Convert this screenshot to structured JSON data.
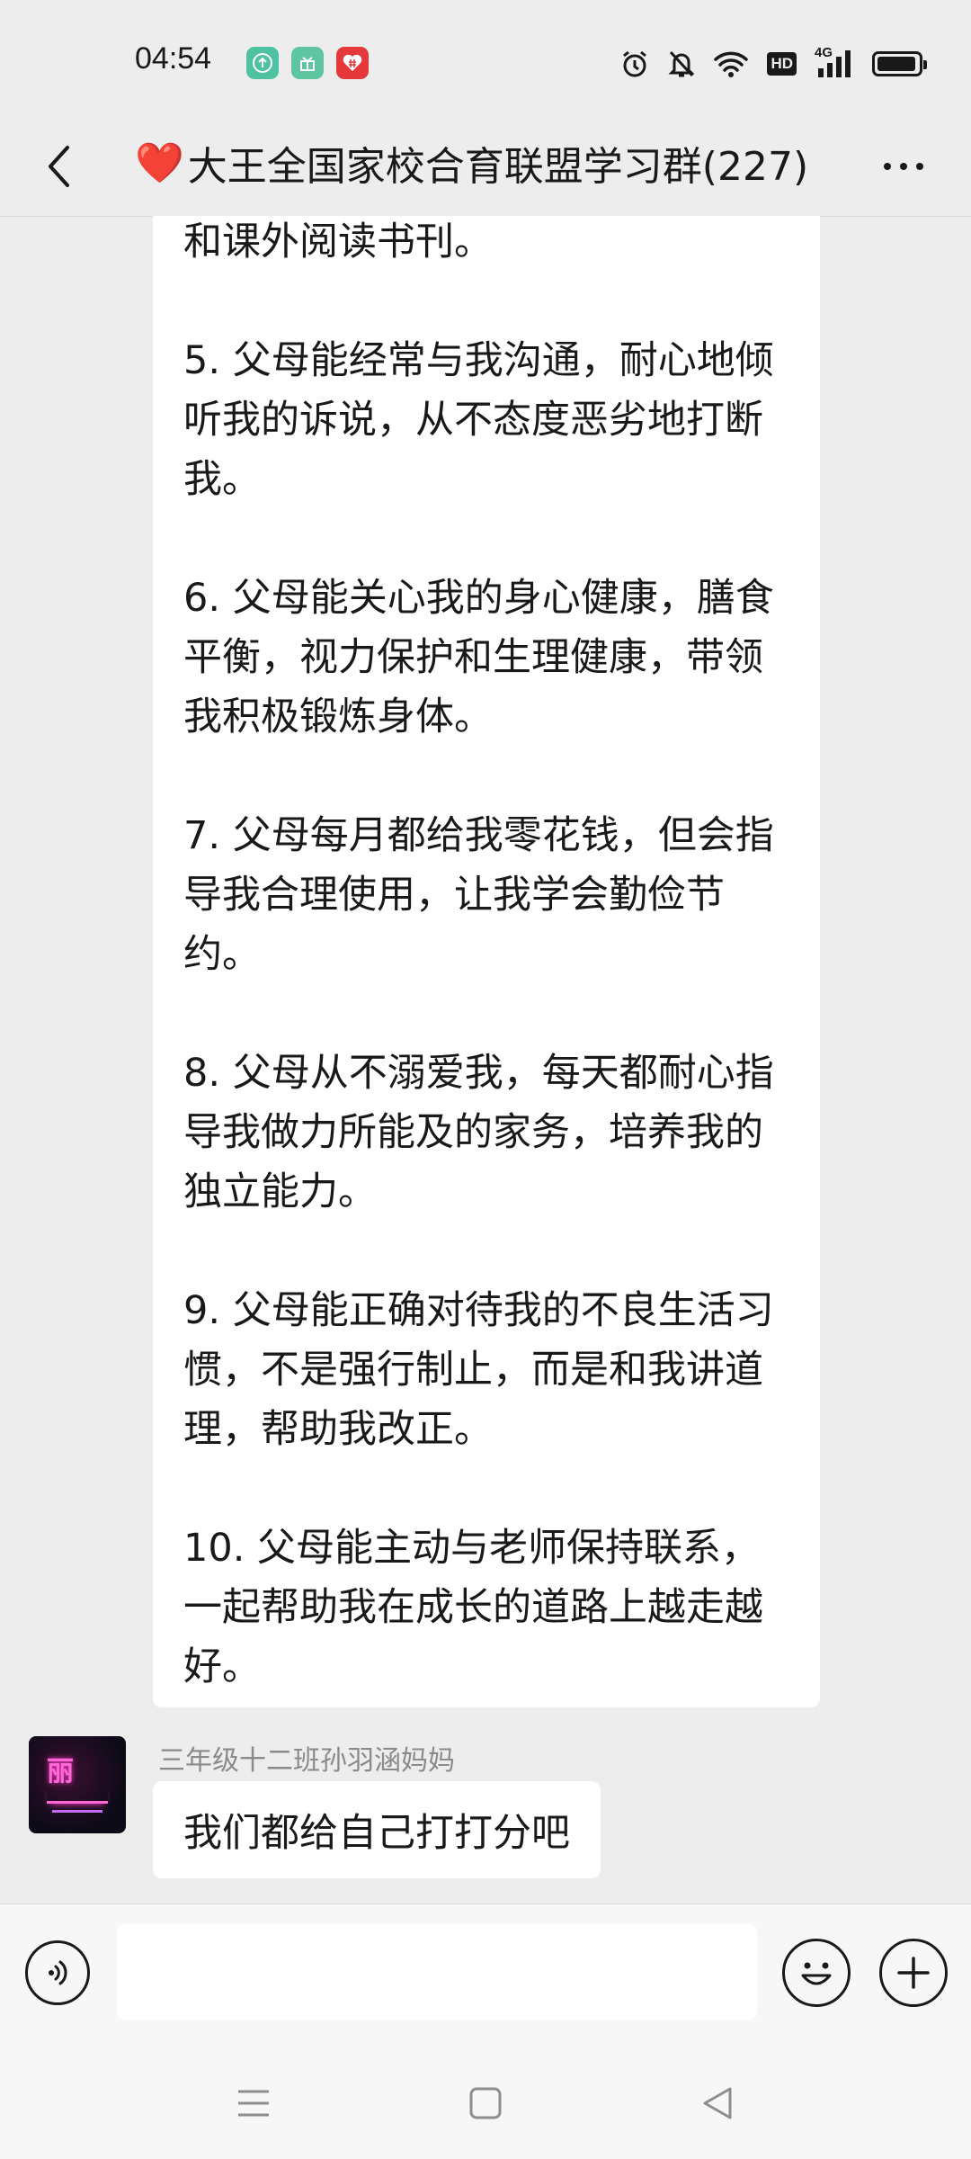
{
  "status_bar": {
    "time": "04:54",
    "apps": [
      {
        "icon": "upload-app-icon",
        "color": "#4fc3a1"
      },
      {
        "icon": "gift-app-icon",
        "color": "#5fc5a0"
      },
      {
        "icon": "heart-grid-app-icon",
        "color": "#e5383b"
      }
    ],
    "indicators": [
      "alarm-icon",
      "mute-icon",
      "wifi-icon",
      "hd-icon",
      "signal-4g-icon",
      "battery-icon"
    ],
    "hd_label": "HD",
    "network_label": "4G",
    "battery_level": 0.95
  },
  "header": {
    "title_emoji": "❤️",
    "title": "大王全国家校合育联盟学习群(227)",
    "back_icon": "chevron-left-icon",
    "more_icon": "more-dots-icon"
  },
  "messages": {
    "long_message_lines": {
      "l0": "和课外阅读书刊。",
      "i5": "5. 父母能经常与我沟通，耐心地倾听我的诉说，从不态度恶劣地打断我。",
      "i6": "6. 父母能关心我的身心健康，膳食平衡，视力保护和生理健康，带领我积极锻炼身体。",
      "i7": "7. 父母每月都给我零花钱，但会指导我合理使用，让我学会勤俭节约。",
      "i8": "8. 父母从不溺爱我，每天都耐心指导我做力所能及的家务，培养我的独立能力。",
      "i9": "9. 父母能正确对待我的不良生活习惯，不是强行制止，而是和我讲道理，帮助我改正。",
      "i10": "10. 父母能主动与老师保持联系，一起帮助我在成长的道路上越走越好。"
    },
    "sender_name": "三年级十二班孙羽涵妈妈",
    "avatar_text": "丽",
    "reply_text": "我们都给自己打打分吧"
  },
  "input_bar": {
    "voice_icon": "voice-icon",
    "input_value": "",
    "emoji_icon": "emoji-icon",
    "plus_icon": "plus-icon"
  },
  "nav_bar": {
    "icons": [
      "menu-icon",
      "home-icon",
      "back-triangle-icon"
    ]
  },
  "colors": {
    "background": "#ededed",
    "bubble": "#ffffff",
    "heart": "#f0435a",
    "sender_name": "#8a8a8a"
  }
}
